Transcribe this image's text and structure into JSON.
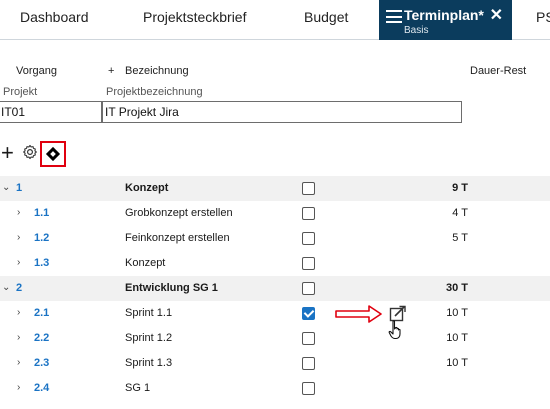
{
  "tabs": [
    {
      "label": "Dashboard"
    },
    {
      "label": "Projektsteckbrief"
    },
    {
      "label": "Budget"
    },
    {
      "label": "Terminplan*",
      "sub": "Basis",
      "active": true
    },
    {
      "label": "PS"
    }
  ],
  "columns": {
    "vorgang": "Vorgang",
    "bezeichnung": "Bezeichnung",
    "bezeichnung_prefix": "+",
    "dauer": "Dauer-Rest"
  },
  "project": {
    "projekt_label": "Projekt",
    "bezeichnung_label": "Projektbezeichnung",
    "projekt_value": "IT01",
    "bezeichnung_value": "IT Projekt Jira"
  },
  "toolbar": {
    "plus": "+",
    "gear_icon": "gear-icon",
    "milestone_icon": "milestone-diamond-icon"
  },
  "rows": [
    {
      "chev": "⌄",
      "num": "1",
      "name": "Konzept",
      "checked": false,
      "dur": "9 T",
      "group": true
    },
    {
      "chev": "›",
      "num": "1.1",
      "name": "Grobkonzept erstellen",
      "checked": false,
      "dur": "4 T",
      "group": false
    },
    {
      "chev": "›",
      "num": "1.2",
      "name": "Feinkonzept erstellen",
      "checked": false,
      "dur": "5 T",
      "group": false
    },
    {
      "chev": "›",
      "num": "1.3",
      "name": "Konzept",
      "checked": false,
      "dur": "",
      "group": false
    },
    {
      "chev": "⌄",
      "num": "2",
      "name": "Entwicklung SG 1",
      "checked": false,
      "dur": "30 T",
      "group": true
    },
    {
      "chev": "›",
      "num": "2.1",
      "name": "Sprint 1.1",
      "checked": true,
      "dur": "10 T",
      "group": false
    },
    {
      "chev": "›",
      "num": "2.2",
      "name": "Sprint 1.2",
      "checked": false,
      "dur": "10 T",
      "group": false
    },
    {
      "chev": "›",
      "num": "2.3",
      "name": "Sprint 1.3",
      "checked": false,
      "dur": "10 T",
      "group": false
    },
    {
      "chev": "›",
      "num": "2.4",
      "name": "SG 1",
      "checked": false,
      "dur": "",
      "group": false
    }
  ],
  "colors": {
    "accent": "#0b3c5d",
    "link": "#1a73c4",
    "highlight": "#e0000f"
  }
}
